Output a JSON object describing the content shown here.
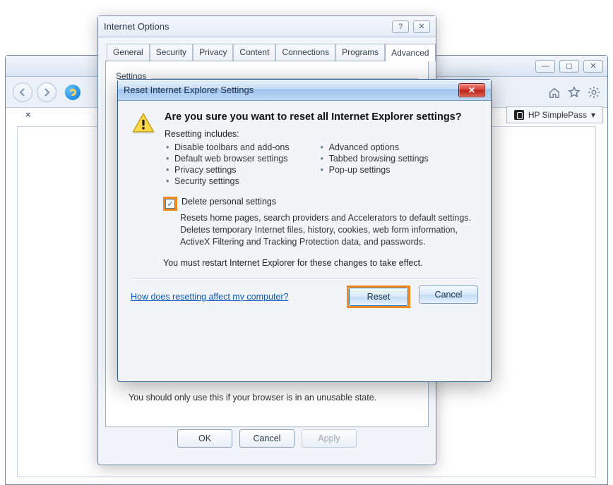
{
  "browser": {
    "simplepass_label": "HP SimplePass",
    "tab_close": "×"
  },
  "iopts": {
    "title": "Internet Options",
    "tabs": [
      "General",
      "Security",
      "Privacy",
      "Content",
      "Connections",
      "Programs",
      "Advanced"
    ],
    "active_tab_index": 6,
    "settings_label": "Settings",
    "unusable_note": "You should only use this if your browser is in an unusable state.",
    "buttons": {
      "ok": "OK",
      "cancel": "Cancel",
      "apply": "Apply"
    }
  },
  "reset": {
    "title": "Reset Internet Explorer Settings",
    "heading": "Are you sure you want to reset all Internet Explorer settings?",
    "includes_label": "Resetting includes:",
    "includes_left": [
      "Disable toolbars and add-ons",
      "Default web browser settings",
      "Privacy settings",
      "Security settings"
    ],
    "includes_right": [
      "Advanced options",
      "Tabbed browsing settings",
      "Pop-up settings"
    ],
    "checkbox_label": "Delete personal settings",
    "checkbox_checked": true,
    "checkbox_desc": "Resets home pages, search providers and Accelerators to default settings. Deletes temporary Internet files, history, cookies, web form information, ActiveX Filtering and Tracking Protection data, and passwords.",
    "restart_note": "You must restart Internet Explorer for these changes to take effect.",
    "link": "How does resetting affect my computer?",
    "buttons": {
      "reset": "Reset",
      "cancel": "Cancel"
    }
  }
}
